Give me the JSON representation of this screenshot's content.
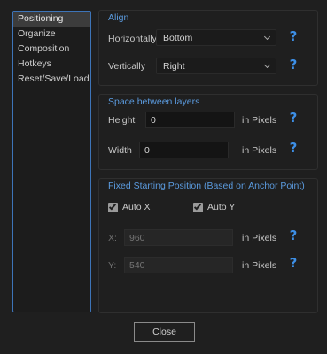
{
  "sidebar": {
    "items": [
      {
        "label": "Positioning"
      },
      {
        "label": "Organize"
      },
      {
        "label": "Composition"
      },
      {
        "label": "Hotkeys"
      },
      {
        "label": "Reset/Save/Load"
      }
    ]
  },
  "align": {
    "title": "Align",
    "horizontal_label": "Horizontally",
    "horizontal_value": "Bottom",
    "vertical_label": "Vertically",
    "vertical_value": "Right",
    "help": "?"
  },
  "spacing": {
    "title": "Space between layers",
    "height_label": "Height",
    "height_value": "0",
    "width_label": "Width",
    "width_value": "0",
    "unit": "in Pixels",
    "help": "?"
  },
  "fixed_start": {
    "title": "Fixed Starting Position (Based on Anchor Point)",
    "auto_x_label": "Auto X",
    "auto_x_checked": true,
    "auto_y_label": "Auto Y",
    "auto_y_checked": true,
    "x_label": "X:",
    "x_placeholder": "960",
    "y_label": "Y:",
    "y_placeholder": "540",
    "unit": "in Pixels",
    "help": "?"
  },
  "footer": {
    "close_label": "Close"
  },
  "colors": {
    "accent": "#3d8fe6",
    "section_title": "#5b9bdf",
    "background": "#1f1f1f"
  }
}
